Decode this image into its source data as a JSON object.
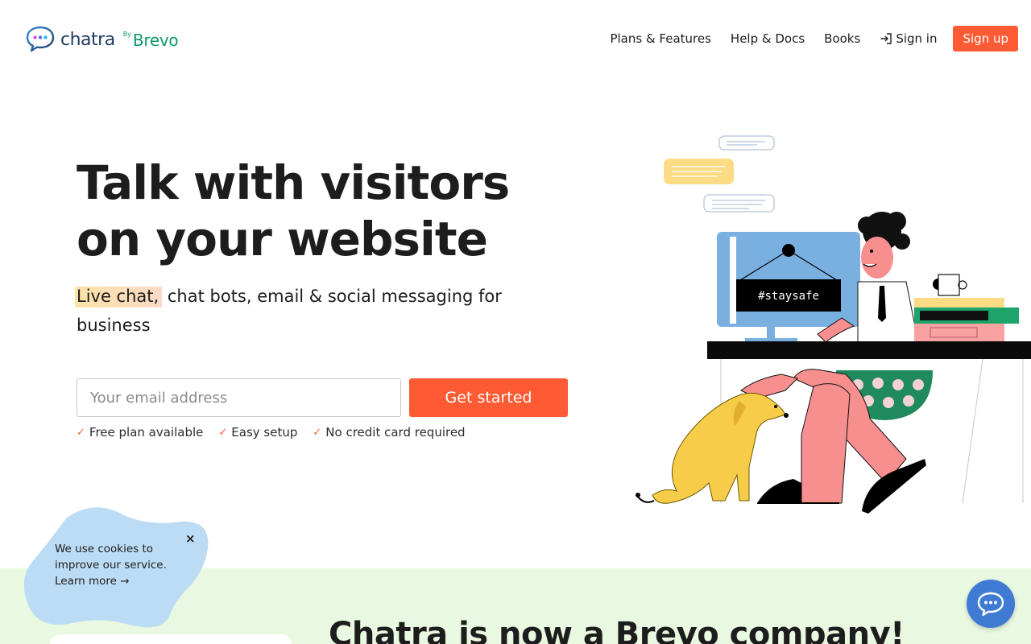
{
  "brand": {
    "name": "chatra",
    "by": "By",
    "partner": "Brevo"
  },
  "nav": {
    "items": [
      {
        "label": "Plans & Features"
      },
      {
        "label": "Help & Docs"
      },
      {
        "label": "Books"
      }
    ],
    "signin_label": "Sign in",
    "signup_label": "Sign up"
  },
  "hero": {
    "title_line1": "Talk with visitors",
    "title_line2": "on your website",
    "subtitle_highlight": "Live chat,",
    "subtitle_rest": " chat bots, email & social messaging for business",
    "email_placeholder": "Your email address",
    "cta_label": "Get started",
    "perks": [
      "Free plan available",
      "Easy setup",
      "No credit card required"
    ],
    "sign_text": "#staysafe"
  },
  "cookie": {
    "text": "We use cookies to improve our service.",
    "link": "Learn more →",
    "close": "×"
  },
  "band": {
    "title": "Chatra is now a Brevo company!"
  },
  "colors": {
    "accent": "#fe5b34",
    "brand_navy": "#1e3a5f",
    "brevo_green": "#0b996e",
    "band_bg": "#e9f9e1",
    "cookie_bg": "#bcdcf5",
    "chat_blue": "#3f7bd3"
  },
  "icons": {
    "signin": "sign-in-icon",
    "check": "check-icon",
    "close": "close-icon",
    "chat": "chat-bubble-icon"
  }
}
